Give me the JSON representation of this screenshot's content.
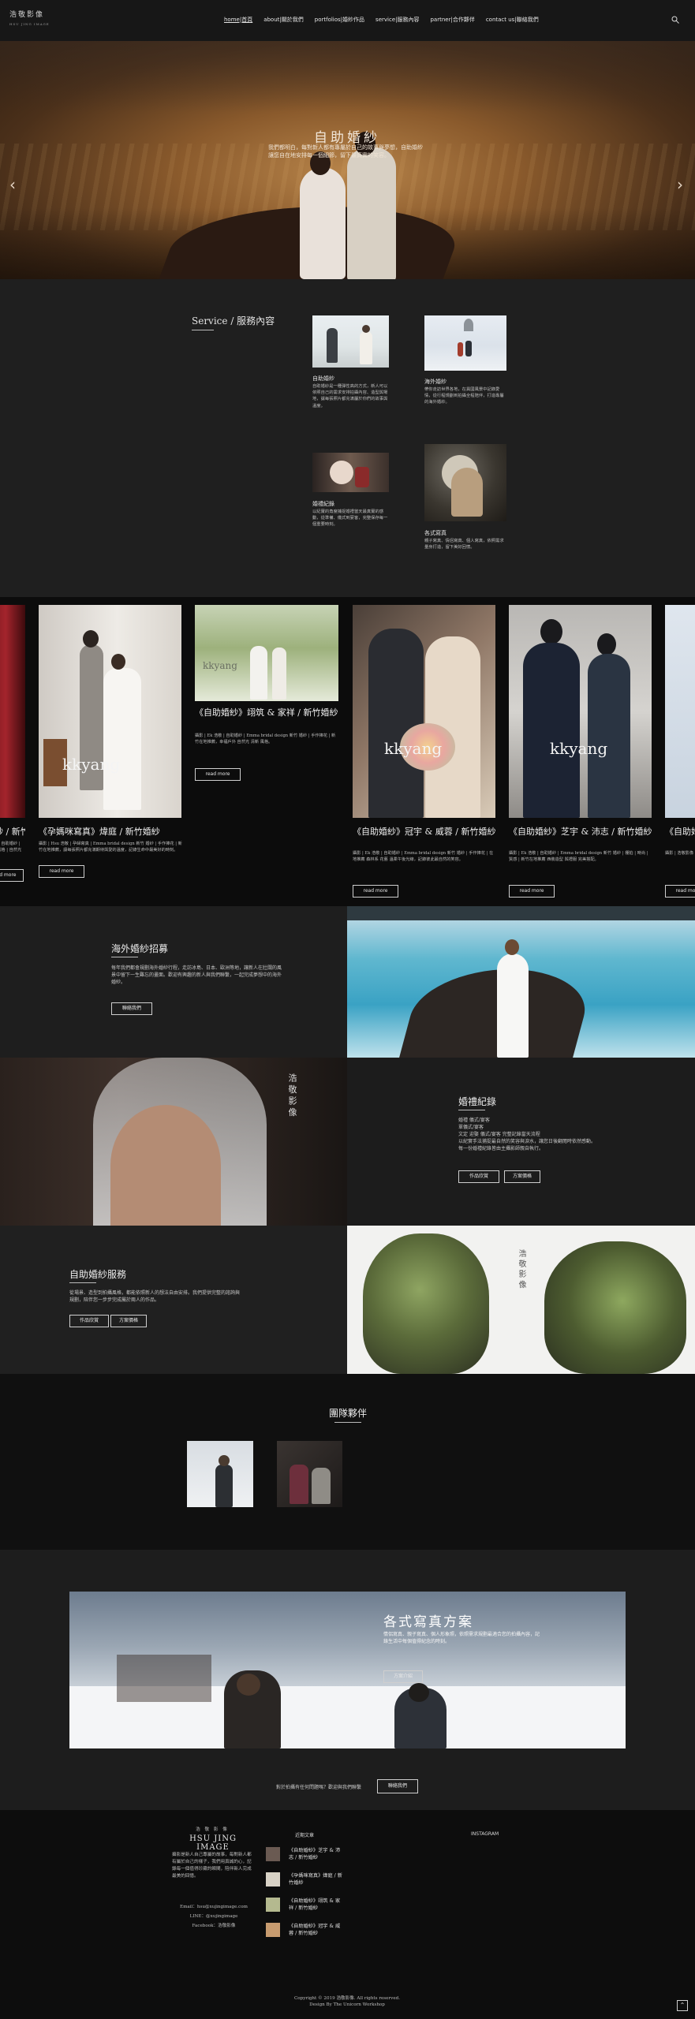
{
  "header": {
    "logo": "浩敬影像",
    "logo_sub": "HSU JING IMAGE",
    "nav": [
      "home|首頁",
      "about|關於我們",
      "portfolios|婚紗作品",
      "service|服務內容",
      "partner|合作夥伴",
      "contact us|聯絡我們"
    ]
  },
  "hero": {
    "title": "自助婚紗",
    "text": "我們都明白，每對新人都有專屬於自己的故事與夢想，自助婚紗讓您自在地安排每一個細節，留下最真實的笑容。",
    "prev": "‹",
    "next": "›"
  },
  "service": {
    "title": "Service / 服務內容",
    "items": [
      {
        "name": "自助婚紗",
        "desc": "自助婚紗是一種彈性高的方式，新人可以依照自己的需求安排拍攝內容、造型與場地，讓每張照片都充滿屬於你們的故事與溫度。"
      },
      {
        "name": "海外婚紗",
        "desc": "帶你走訪世界各地，在異國風景中記錄愛情，從行程規劃到拍攝全程陪伴，打造專屬的海外婚紗。"
      },
      {
        "name": "婚禮紀錄",
        "desc": "以紀實的角度捕捉婚禮當天最真實的感動，從準備、儀式到宴客，完整保存每一個重要時刻。"
      },
      {
        "name": "各式寫真",
        "desc": "親子寫真、情侶寫真、個人寫真，依照需求量身打造，留下美好回憶。"
      }
    ]
  },
  "carousel": {
    "cards": [
      {
        "title": "自助婚紗 / 新竹婚紗",
        "desc": "攝影 | 浩敬影像 | 自助婚紗 | 新竹婚紗 | 唯美風格 | 自然光拍攝 | 新人推薦",
        "button": "read more"
      },
      {
        "title": "《孕媽咪寫真》煒庭 / 新竹婚紗",
        "desc": "攝影 | Hsu 浩敬 | 孕婦寫真 | Emma bridal design 新竹 婚紗 | 手作捧花 | 新竹在地推薦，讓每張照片都充滿期待與愛的溫度，記錄生命中最美好的時刻。",
        "button": "read more"
      },
      {
        "title": "《自助婚紗》翊筑 & 家祥 / 新竹婚紗",
        "desc": "攝影 | Ek 浩敬 | 自助婚紗 | Emma bridal design 新竹 婚紗 | 手作捧花 | 新竹在地推薦，幸福戶外 自然光 清新 風格。",
        "button": "read more"
      },
      {
        "title": "《自助婚紗》冠宇 & 威蓉 / 新竹婚紗",
        "desc": "攝影 | Ek 浩敬 | 自助婚紗 | Emma bridal design 新竹 婚紗 | 手作捧花 | 在地推薦 森林系 花藝 溫柔午後光線，記錄彼此最自然的笑容。",
        "button": "read more"
      },
      {
        "title": "《自助婚紗》芝宇 & 沛志 / 新竹婚紗",
        "desc": "攝影 | Ek 浩敬 | 自助婚紗 | Emma bridal design 新竹 婚紗 | 棚拍 | 時尚 | 質感 | 新竹在地推薦 西裝造型 與禮服 完美搭配。",
        "button": "read more"
      },
      {
        "title": "《自助婚紗》",
        "desc": "攝影 | 浩敬影像",
        "button": "read more"
      }
    ],
    "watermark": "kkyang"
  },
  "overseas": {
    "title": "海外婚紗招募",
    "text": "每年我們都會規劃海外婚紗行程，走訪冰島、日本、歐洲等地，讓新人在壯闊的風景中留下一生難忘的畫面。歡迎有興趣的新人與我們聯繫，一起完成夢想中的海外婚紗。",
    "button": "聯絡我們"
  },
  "wedding": {
    "title": "婚禮紀錄",
    "text": "婚禮 儀式/宴客\n單儀式/宴客\n文定 迎娶 儀式/宴客 完整記錄當天流程\n以紀實手法捕捉最自然的笑容與淚水，讓您日後翻閱時依然感動。\n每一份婚禮紀錄皆由主攝影師親自執行。",
    "buttons": [
      "作品欣賞",
      "方案價格"
    ],
    "vertical": "浩 敬 影 像"
  },
  "selfservice": {
    "title": "自助婚紗服務",
    "text": "從場景、造型到拍攝風格，都能依照新人的想法自由安排。我們提供完整的諮詢與規劃，陪伴您一步步完成屬於兩人的作品。",
    "buttons": [
      "作品欣賞",
      "方案價格"
    ],
    "vertical": "浩 敬 影 像"
  },
  "partners": {
    "title": "團隊夥伴"
  },
  "portrait": {
    "title": "各式寫真方案",
    "text": "情侶寫真、親子寫真、個人形象照，依照需求規劃最適合您的拍攝內容，記錄生活中每個值得紀念的時刻。",
    "button": "方案介紹"
  },
  "cta": {
    "text": "對於拍攝有任何問題嗎？歡迎與我們聯繫",
    "button": "聯絡我們"
  },
  "footer": {
    "logo_top": "浩 敬 影 像",
    "logo": "HSU JING IMAGE",
    "about": "攝影是新人自己專屬的故事，每對新人都有屬於自己的樣子，我們用真誠的心，記錄每一個值得珍藏的瞬間，陪伴新人完成最美的回憶。",
    "email": "Email：hsu@xujingimage.com",
    "line": "LINE：@xujingimage",
    "facebook": "Facebook：浩敬影像",
    "recent_title": "近期文章",
    "instagram_title": "INSTAGRAM",
    "posts": [
      "《自助婚紗》芝宇 & 沛志 / 新竹婚紗",
      "《孕媽咪寫真》煒庭 / 新竹婚紗",
      "《自助婚紗》翊筑 & 家祥 / 新竹婚紗",
      "《自助婚紗》冠宇 & 威蓉 / 新竹婚紗"
    ],
    "copyright": "Copyright © 2019 浩敬影像. All rights reserved.",
    "design": "Design By The Unicorn Workshop",
    "top_button": "⌃"
  },
  "colors": {
    "accent": "#b7844a",
    "background": "#1f1f1f"
  }
}
